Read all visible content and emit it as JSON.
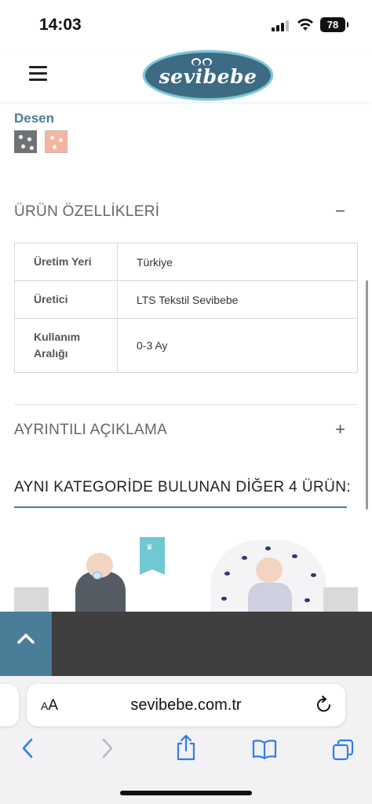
{
  "status_bar": {
    "time": "14:03",
    "battery": "78"
  },
  "header": {
    "logo_text": "sevibebe"
  },
  "pattern": {
    "label": "Desen",
    "swatches": [
      {
        "name": "gray",
        "color": "#6f7275"
      },
      {
        "name": "peach",
        "color": "#f6b5a0"
      }
    ]
  },
  "features": {
    "title": "ÜRÜN ÖZELLİKLERİ",
    "toggle": "−",
    "rows": [
      {
        "key": "Üretim Yeri",
        "value": "Türkiye"
      },
      {
        "key": "Üretici",
        "value": "LTS Tekstil Sevibebe"
      },
      {
        "key": "Kullanım Aralığı",
        "value": "0-3 Ay"
      }
    ]
  },
  "description": {
    "title": "AYRINTILI AÇIKLAMA",
    "toggle": "+"
  },
  "same_category": {
    "title": "AYNI KATEGORİDE BULUNAN DİĞER 4 ÜRÜN:"
  },
  "browser": {
    "text_size_label": "AA",
    "url": "sevibebe.com.tr"
  },
  "colors": {
    "accent": "#4a7d97",
    "footer": "#3f3f3f",
    "logo_bg": "#3d6b83"
  }
}
